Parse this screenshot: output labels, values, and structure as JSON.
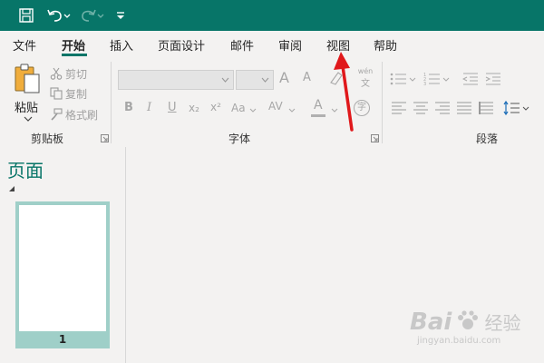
{
  "tabs": [
    "文件",
    "开始",
    "插入",
    "页面设计",
    "邮件",
    "审阅",
    "视图",
    "帮助"
  ],
  "active_tab": "开始",
  "clipboard": {
    "paste_label": "粘贴",
    "cut_label": "剪切",
    "copy_label": "复制",
    "format_painter_label": "格式刷",
    "group_label": "剪贴板"
  },
  "font": {
    "group_label": "字体",
    "font_name_value": "",
    "font_size_value": "",
    "bold": "B",
    "italic": "I",
    "underline": "U",
    "subscript": "x₂",
    "superscript": "x²",
    "change_case": "Aa",
    "char_spacing": "AV",
    "font_color": "A",
    "grow": "A",
    "shrink": "A",
    "phonetic": "wén",
    "phonetic_sub": "文",
    "enclose": "字"
  },
  "paragraph": {
    "group_label": "段落"
  },
  "pages_panel": {
    "title": "页面",
    "page_number": "1"
  },
  "watermark": {
    "brand": "Bai",
    "brand_cn": "经验",
    "url": "jingyan.baidu.com"
  },
  "colors": {
    "accent": "#077568",
    "arrow": "#e0181b"
  }
}
